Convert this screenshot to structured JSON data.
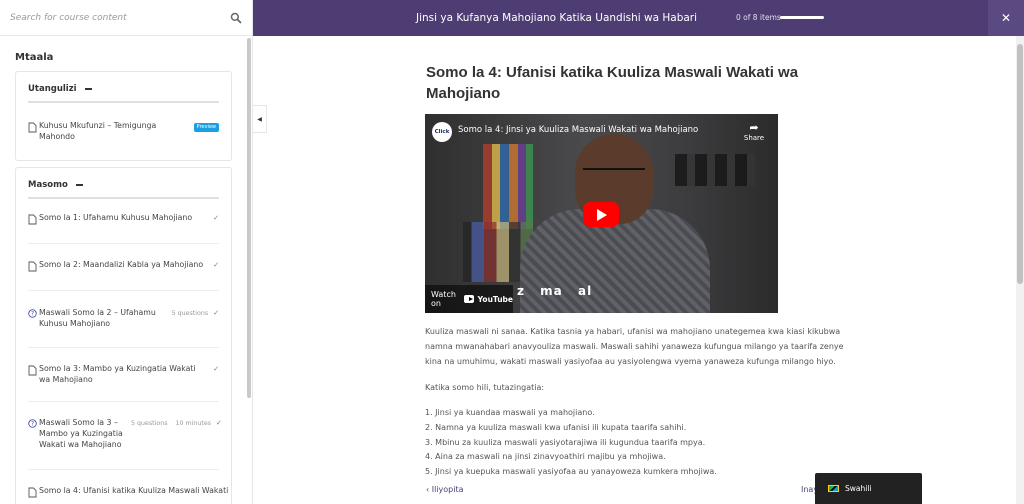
{
  "sidebar": {
    "search_placeholder": "Search for course content",
    "curriculum_title": "Mtaala",
    "sections": [
      {
        "title": "Utangulizi",
        "items": [
          {
            "type": "lesson",
            "label": "Kuhusu Mkufunzi – Temigunga Mahondo",
            "badge": "Preview"
          }
        ]
      },
      {
        "title": "Masomo",
        "items": [
          {
            "type": "lesson",
            "label": "Somo la 1: Ufahamu Kuhusu Mahojiano"
          },
          {
            "type": "lesson",
            "label": "Somo la 2: Maandalizi Kabla ya Mahojiano"
          },
          {
            "type": "quiz",
            "label": "Maswali Somo la 2 – Ufahamu Kuhusu Mahojiano",
            "meta": "5 questions"
          },
          {
            "type": "lesson",
            "label": "Somo la 3: Mambo ya Kuzingatia Wakati wa Mahojiano"
          },
          {
            "type": "quiz",
            "label": "Maswali Somo la 3 – Mambo ya Kuzingatia Wakati wa Mahojiano",
            "meta": "5 questions",
            "meta2": "10 minutes"
          },
          {
            "type": "lesson",
            "label": "Somo la 4: Ufanisi katika Kuuliza Maswali Wakati"
          }
        ]
      }
    ]
  },
  "header": {
    "course_title": "Jinsi ya Kufanya Mahojiano Katika Uandishi wa Habari",
    "items_count": "0 of 8 items",
    "progress": 0
  },
  "lesson": {
    "title": "Somo la 4: Ufanisi katika Kuuliza Maswali Wakati wa Mahojiano",
    "video": {
      "channel_logo": "Click",
      "title": "Somo la 4: Jinsi ya Kuuliza Maswali Wakati wa Mahojiano",
      "share_label": "Share",
      "watch_on": "Watch on",
      "youtube": "YouTube",
      "caption": [
        "z",
        "ma",
        "al"
      ]
    },
    "paragraph1": "Kuuliza maswali ni sanaa. Katika tasnia ya habari, ufanisi wa mahojiano unategemea kwa kiasi kikubwa namna mwanahabari anavyouliza maswali. Maswali sahihi yanaweza kufungua milango ya taarifa zenye kina na umuhimu, wakati maswali yasiyofaa au yasiyolengwa vyema yanaweza kufunga milango hiyo.",
    "paragraph2": "Katika somo hili, tutazingatia:",
    "points": [
      "1. Jinsi ya kuandaa maswali ya mahojiano.",
      "2. Namna ya kuuliza maswali kwa ufanisi ili kupata taarifa sahihi.",
      "3. Mbinu za kuuliza maswali yasiyotarajiwa ili kugundua taarifa mpya.",
      "4. Aina za maswali na jinsi zinavyoathiri majibu ya mhojiwa.",
      "5. Jinsi ya kuepuka maswali yasiyofaa au yanayoweza kumkera mhojiwa."
    ],
    "prev_label": "Iliyopita",
    "next_label": "Inay"
  },
  "language": {
    "label": "Swahili"
  },
  "colors": {
    "accent": "#4e3d73",
    "badge": "#1aa0e0",
    "youtube_red": "#ff0000"
  }
}
